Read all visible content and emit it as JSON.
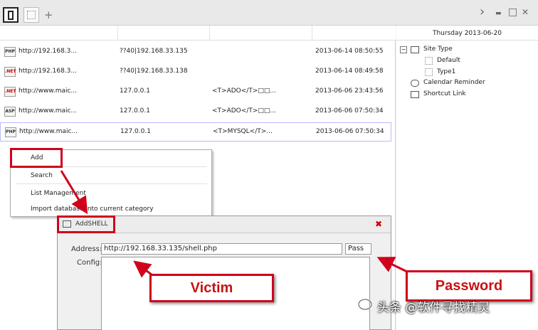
{
  "tabs": [
    {
      "icon": "panel-icon"
    },
    {
      "icon": "blank-tab-icon"
    }
  ],
  "tab_add_label": "+",
  "window_controls": {
    "next": "›",
    "minimize": "▬",
    "maximize": "□",
    "close": "✕"
  },
  "rows": [
    {
      "type": "PHP",
      "url": "http://192.168.3...",
      "ip": "??40|192.168.33.135",
      "db": "",
      "date": "2013-06-14 08:50:55"
    },
    {
      "type": ".NET",
      "url": "http://192.168.3...",
      "ip": "??40|192.168.33.138",
      "db": "",
      "date": "2013-06-14 08:49:58"
    },
    {
      "type": ".NET",
      "url": "http://www.maic...",
      "ip": "127.0.0.1",
      "db": "<T>ADO</T>□□...",
      "date": "2013-06-06 23:43:56"
    },
    {
      "type": "ASP",
      "url": "http://www.maic...",
      "ip": "127.0.0.1",
      "db": "<T>ADO</T>□□...",
      "date": "2013-06-06 07:50:34"
    },
    {
      "type": "PHP",
      "url": "http://www.maic...",
      "ip": "127.0.0.1",
      "db": "<T>MYSQL</T>...",
      "date": "2013-06-06 07:50:34"
    }
  ],
  "sidebar": {
    "date": "Thursday 2013-06-20",
    "site_type": "Site Type",
    "default": "Default",
    "type1": "Type1",
    "calendar": "Calendar Reminder",
    "shortcut": "Shortcut Link",
    "collapse_glyph": "−"
  },
  "context_menu": {
    "add": "Add",
    "search": "Search",
    "list_management": "List Management",
    "import": "Import database into current category"
  },
  "dialog": {
    "title": "AddSHELL",
    "close": "✖",
    "address_label": "Address:",
    "address_value": "http://192.168.33.135/shell.php",
    "pass_value": "Pass",
    "config_label": "Config:"
  },
  "callouts": {
    "victim": "Victim",
    "password": "Password"
  },
  "watermark": "头条 @软件寻找精灵",
  "colors": {
    "accent_red": "#d0021b"
  }
}
